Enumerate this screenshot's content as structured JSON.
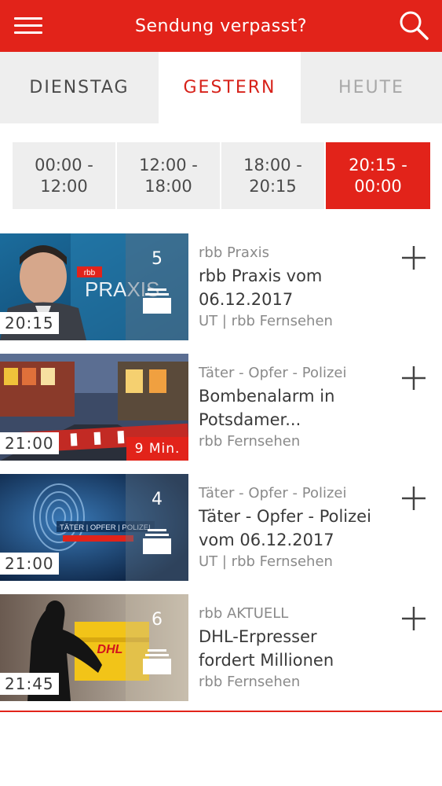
{
  "header": {
    "title": "Sendung verpasst?",
    "accent_color": "#e2231a",
    "menu_icon": "hamburger-menu-icon",
    "search_icon": "search-icon"
  },
  "day_tabs": [
    {
      "label": "DIENSTAG",
      "state": "normal"
    },
    {
      "label": "GESTERN",
      "state": "selected"
    },
    {
      "label": "HEUTE",
      "state": "disabled"
    }
  ],
  "time_slots": [
    {
      "line1": "00:00 -",
      "line2": "12:00"
    },
    {
      "line1": "12:00 -",
      "line2": "18:00"
    },
    {
      "line1": "18:00 -",
      "line2": "20:15"
    },
    {
      "line1": "20:15 -",
      "line2": "00:00",
      "selected": true
    }
  ],
  "items": [
    {
      "time": "20:15",
      "count": "5",
      "category": "rbb Praxis",
      "title_line1": "rbb Praxis vom",
      "title_line2": "06.12.2017",
      "subtitle": "UT | rbb Fernsehen",
      "thumb_text": "PRAXIS",
      "thumb_logo": "rbb"
    },
    {
      "time": "21:00",
      "duration": "9 Min.",
      "category": "Täter - Opfer - Polizei",
      "title_line1": "Bombenalarm in",
      "title_line2": "Potsdamer...",
      "subtitle": "rbb Fernsehen"
    },
    {
      "time": "21:00",
      "count": "4",
      "category": "Täter - Opfer - Polizei",
      "title_line1": "Täter - Opfer - Polizei",
      "title_line2": "vom 06.12.2017",
      "subtitle": "UT | rbb Fernsehen",
      "thumb_text": "TÄTER | OPFER | POLIZEI"
    },
    {
      "time": "21:45",
      "count": "6",
      "category": "rbb AKTUELL",
      "title_line1": "DHL-Erpresser",
      "title_line2": "fordert Millionen",
      "subtitle": "rbb Fernsehen",
      "thumb_text": "DHL"
    }
  ]
}
